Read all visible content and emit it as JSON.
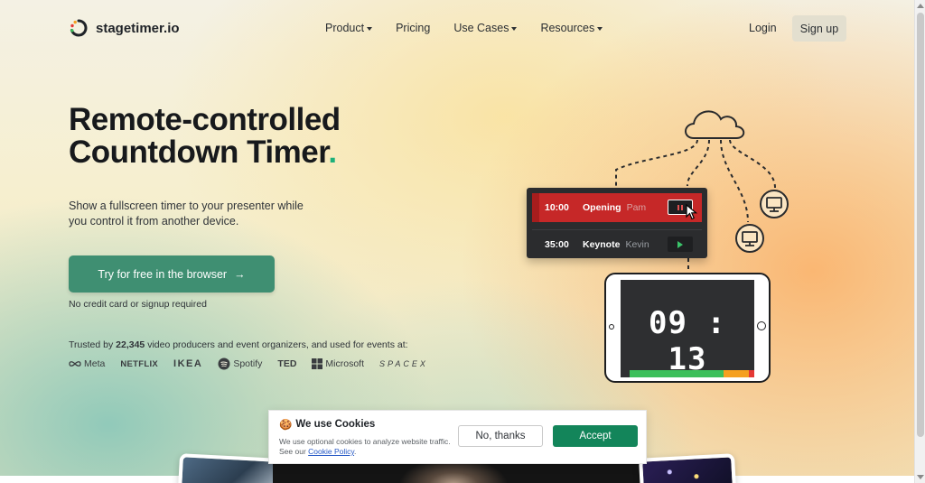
{
  "nav": {
    "logo_text": "stagetimer",
    "logo_tld": ".io",
    "links": [
      {
        "label": "Product",
        "dropdown": true
      },
      {
        "label": "Pricing",
        "dropdown": false
      },
      {
        "label": "Use Cases",
        "dropdown": true
      },
      {
        "label": "Resources",
        "dropdown": true
      }
    ],
    "login": "Login",
    "signup": "Sign up"
  },
  "hero": {
    "headline_line1": "Remote-controlled",
    "headline_line2": "Countdown Timer",
    "headline_dot": ".",
    "subtitle": "Show a fullscreen timer to your presenter while you control it from another device.",
    "cta_label": "Try for free in the browser",
    "cta_arrow": "→",
    "cta_note": "No credit card or signup required",
    "trusted_prefix": "Trusted by",
    "trusted_count": "22,345",
    "trusted_suffix": "video producers and event organizers, and used for events at:",
    "brands": [
      "Meta",
      "NETFLIX",
      "IKEA",
      "Spotify",
      "TED",
      "Microsoft",
      "SPACEX"
    ]
  },
  "illustration": {
    "timers": [
      {
        "time": "10:00",
        "title": "Opening",
        "speaker": "Pam",
        "state": "running"
      },
      {
        "time": "35:00",
        "title": "Keynote",
        "speaker": "Kevin",
        "state": "idle"
      }
    ],
    "display_time_min": "09",
    "display_time_sep": ":",
    "display_time_sec": "13",
    "progress": {
      "elapsed_green": 0.7,
      "warning_orange": 0.19,
      "danger_red": 0.05
    }
  },
  "cookie": {
    "icon": "🍪",
    "title": "We use Cookies",
    "text": "We use optional cookies to analyze website traffic. See our",
    "link": "Cookie Policy",
    "text_end": ".",
    "decline": "No, thanks",
    "accept": "Accept"
  },
  "colors": {
    "brand_green": "#3f8f72",
    "accept_green": "#13855a",
    "timer_red": "#c62828"
  }
}
